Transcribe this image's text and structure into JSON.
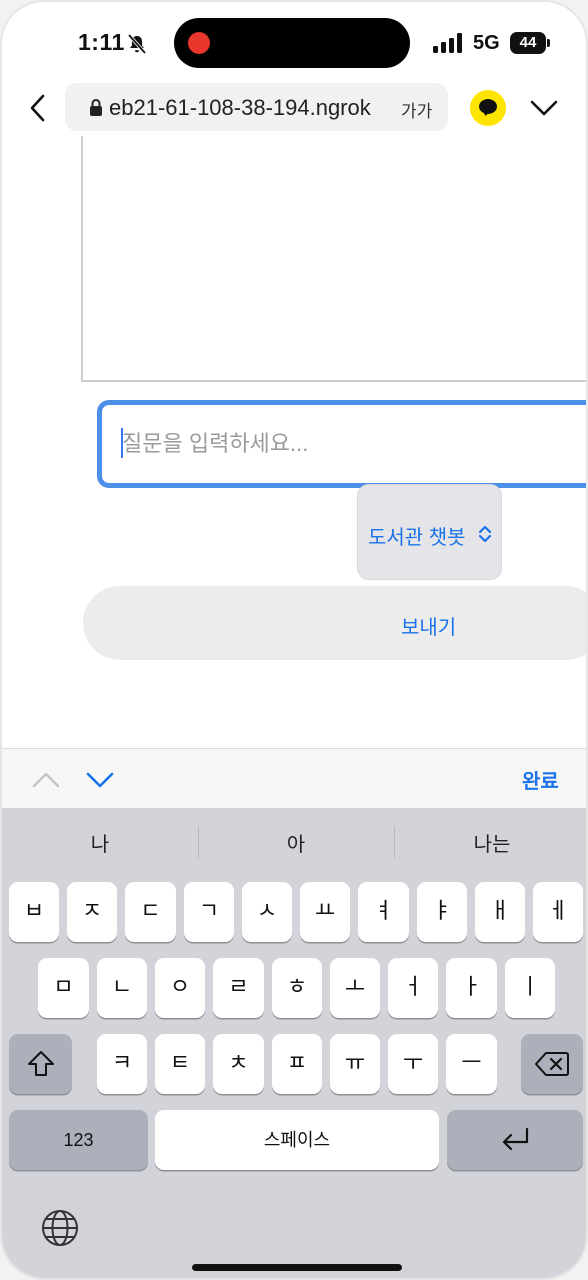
{
  "status_bar": {
    "time": "1:11",
    "network": "5G",
    "battery": "44"
  },
  "browser": {
    "url": "eb21-61-108-38-194.ngrok",
    "text_size_label": "가가"
  },
  "page": {
    "question_placeholder": "질문을 입력하세요...",
    "select_value": "도서관 챗봇",
    "send_label": "보내기"
  },
  "keyboard_toolbar": {
    "done_label": "완료"
  },
  "keyboard": {
    "suggestions": [
      "나",
      "아",
      "나는"
    ],
    "row1": [
      "ㅂ",
      "ㅈ",
      "ㄷ",
      "ㄱ",
      "ㅅ",
      "ㅛ",
      "ㅕ",
      "ㅑ",
      "ㅐ",
      "ㅔ"
    ],
    "row2": [
      "ㅁ",
      "ㄴ",
      "ㅇ",
      "ㄹ",
      "ㅎ",
      "ㅗ",
      "ㅓ",
      "ㅏ",
      "ㅣ"
    ],
    "row3": [
      "ㅋ",
      "ㅌ",
      "ㅊ",
      "ㅍ",
      "ㅠ",
      "ㅜ",
      "ㅡ"
    ],
    "numbers_label": "123",
    "space_label": "스페이스"
  },
  "colors": {
    "accent": "#1a73e8",
    "input_border": "#4d8fe8",
    "kakao": "#fee500",
    "recording": "#e8362d"
  }
}
